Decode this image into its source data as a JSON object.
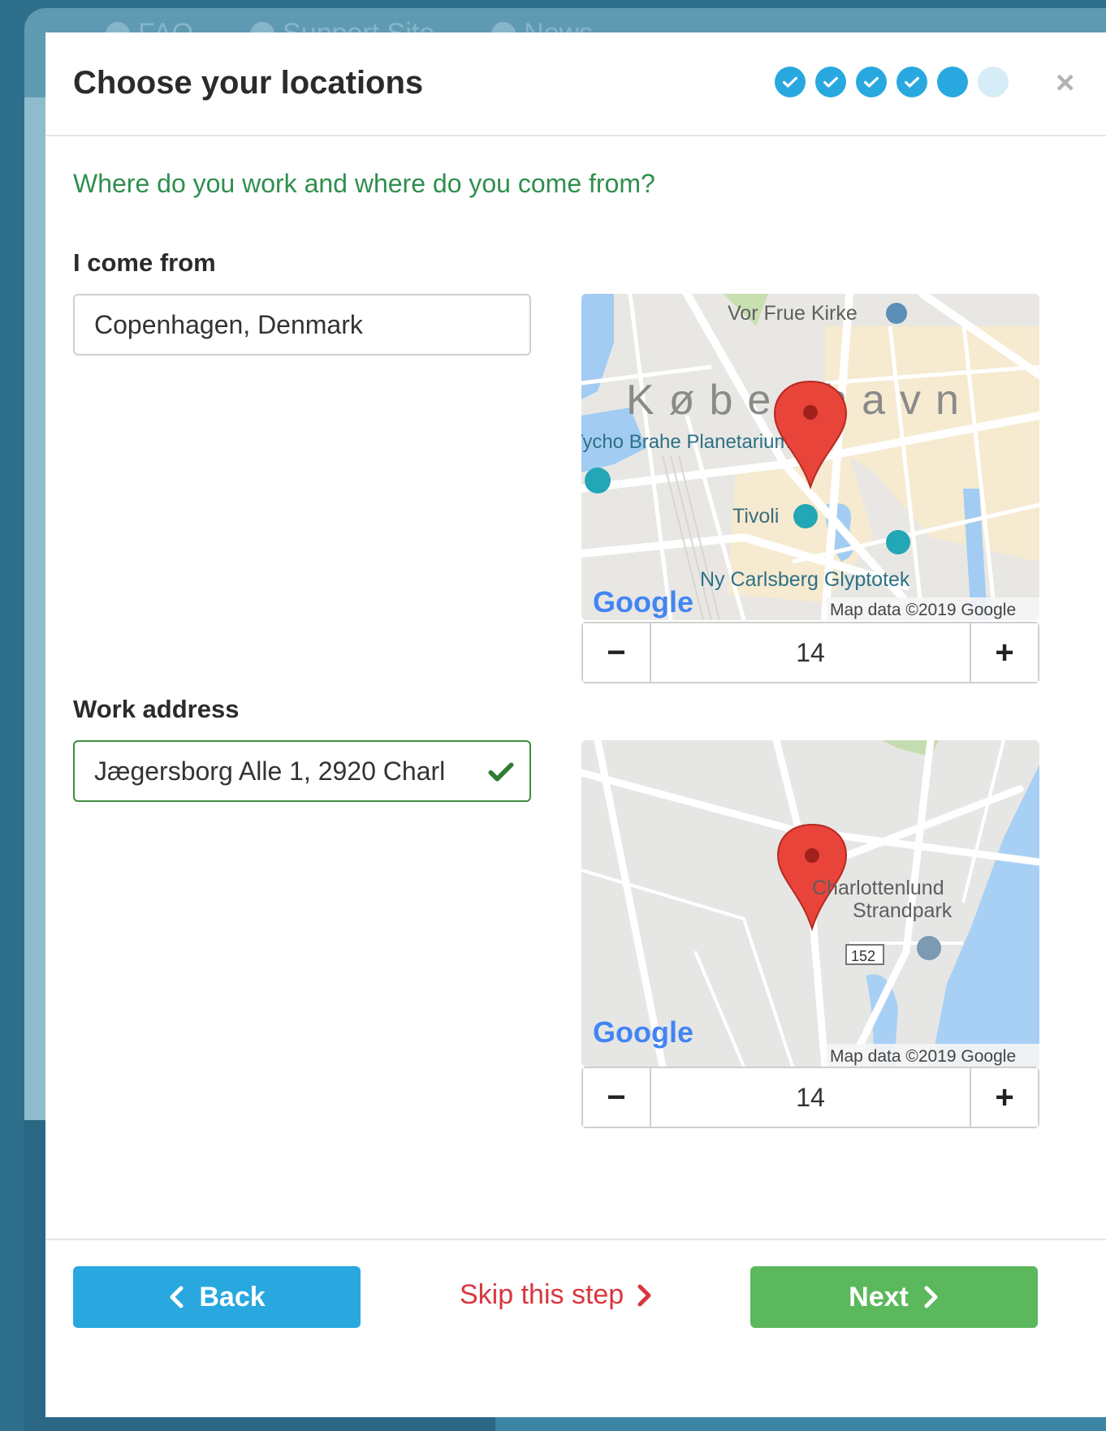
{
  "background": {
    "nav": [
      "FAQ",
      "Support Site",
      "News"
    ]
  },
  "modal": {
    "title": "Choose your locations",
    "steps": [
      "done",
      "done",
      "done",
      "done",
      "current",
      "todo"
    ],
    "close_label": "×",
    "subtitle": "Where do you work and where do you come from?"
  },
  "origin": {
    "label": "I come from",
    "value": "Copenhagen, Denmark",
    "map": {
      "city_label": "København",
      "poi_1": "Vor Frue Kirke",
      "poi_2": "Tycho Brahe Planetarium",
      "poi_3": "Tivoli",
      "poi_4": "Ny Carlsberg Glyptotek",
      "logo": "Google",
      "attribution": "Map data ©2019 Google"
    },
    "zoom": "14",
    "minus": "−",
    "plus": "+"
  },
  "work": {
    "label": "Work address",
    "value": "Jægersborg Alle 1, 2920 Charl",
    "map": {
      "poi_1": "Charlottenlund",
      "poi_2": "Strandpark",
      "road_shield": "152",
      "logo": "Google",
      "attribution": "Map data ©2019 Google"
    },
    "zoom": "14",
    "minus": "−",
    "plus": "+"
  },
  "footer": {
    "back_label": "Back",
    "skip_label": "Skip this step",
    "next_label": "Next"
  },
  "colors": {
    "primary": "#29a8e0",
    "success": "#5cb85c",
    "danger": "#d9363e",
    "subtitle": "#2f8f4e"
  }
}
